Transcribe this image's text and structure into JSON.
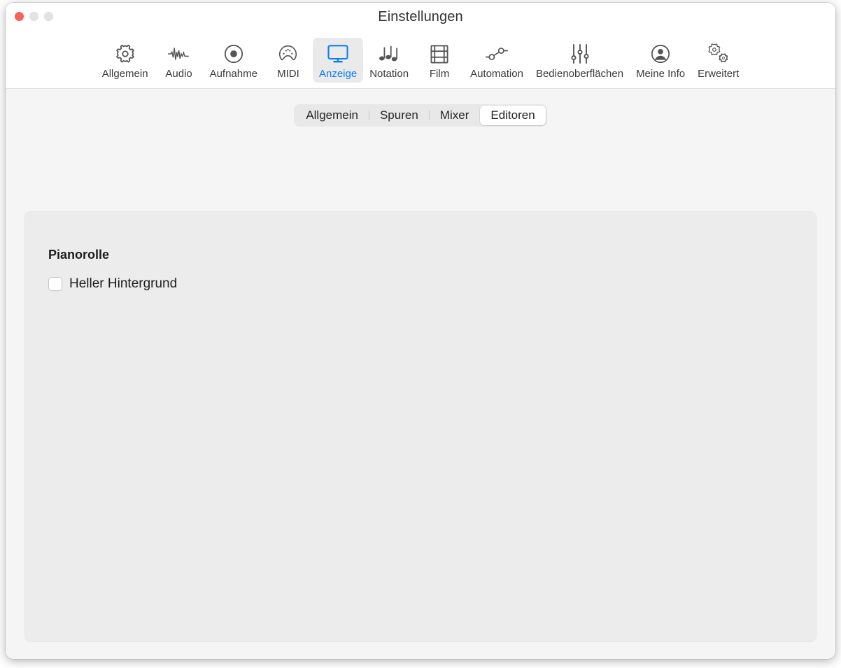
{
  "window": {
    "title": "Einstellungen",
    "traffic_lights": [
      {
        "name": "close",
        "color": "#ff6257"
      },
      {
        "name": "minimize",
        "color": "#e3e3e3"
      },
      {
        "name": "zoom",
        "color": "#e3e3e3"
      }
    ]
  },
  "toolbar": {
    "items": [
      {
        "label": "Allgemein",
        "icon": "gear-icon",
        "selected": false
      },
      {
        "label": "Audio",
        "icon": "waveform-icon",
        "selected": false
      },
      {
        "label": "Aufnahme",
        "icon": "record-icon",
        "selected": false
      },
      {
        "label": "MIDI",
        "icon": "midi-connector-icon",
        "selected": false
      },
      {
        "label": "Anzeige",
        "icon": "display-monitor-icon",
        "selected": true
      },
      {
        "label": "Notation",
        "icon": "music-notes-icon",
        "selected": false
      },
      {
        "label": "Film",
        "icon": "film-strip-icon",
        "selected": false
      },
      {
        "label": "Automation",
        "icon": "automation-curve-icon",
        "selected": false
      },
      {
        "label": "Bedienoberflächen",
        "icon": "sliders-icon",
        "selected": false
      },
      {
        "label": "Meine Info",
        "icon": "person-circle-icon",
        "selected": false
      },
      {
        "label": "Erweitert",
        "icon": "double-gear-icon",
        "selected": false
      }
    ],
    "accent_color": "#0a7cff"
  },
  "tabs": [
    {
      "label": "Allgemein",
      "selected": false
    },
    {
      "label": "Spuren",
      "selected": false
    },
    {
      "label": "Mixer",
      "selected": false
    },
    {
      "label": "Editoren",
      "selected": true
    }
  ],
  "content": {
    "section_title": "Pianorolle",
    "checkbox": {
      "label": "Heller Hintergrund",
      "checked": false
    }
  }
}
